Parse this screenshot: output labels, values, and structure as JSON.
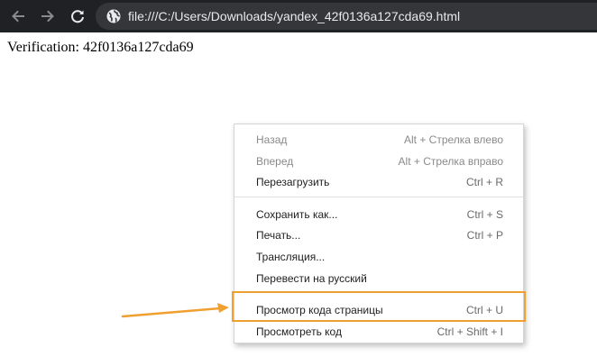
{
  "browser": {
    "url": "file:///C:/Users/Downloads/yandex_42f0136a127cda69.html",
    "buttons": {
      "back": "arrow-left-icon",
      "forward": "arrow-right-icon",
      "reload": "reload-icon"
    },
    "site_icon": "globe-icon"
  },
  "page": {
    "verification_text": "Verification: 42f0136a127cda69"
  },
  "context_menu": {
    "groups": [
      [
        {
          "label": "Назад",
          "shortcut": "Alt + Стрелка влево",
          "disabled": true
        },
        {
          "label": "Вперед",
          "shortcut": "Alt + Стрелка вправо",
          "disabled": true
        },
        {
          "label": "Перезагрузить",
          "shortcut": "Ctrl + R",
          "disabled": false
        }
      ],
      [
        {
          "label": "Сохранить как...",
          "shortcut": "Ctrl + S",
          "disabled": false
        },
        {
          "label": "Печать...",
          "shortcut": "Ctrl + P",
          "disabled": false
        },
        {
          "label": "Трансляция...",
          "shortcut": "",
          "disabled": false
        },
        {
          "label": "Перевести на русский",
          "shortcut": "",
          "disabled": false
        }
      ],
      [
        {
          "label": "Просмотр кода страницы",
          "shortcut": "Ctrl + U",
          "disabled": false,
          "highlighted": true
        },
        {
          "label": "Просмотреть код",
          "shortcut": "Ctrl + Shift + I",
          "disabled": false
        }
      ]
    ]
  },
  "annotation": {
    "color": "#f0a030"
  }
}
